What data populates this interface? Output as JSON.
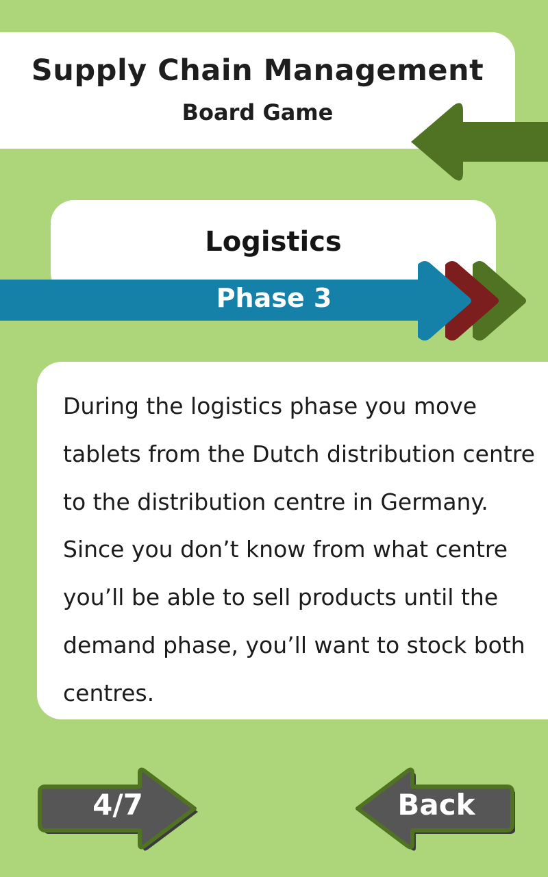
{
  "header": {
    "title": "Supply Chain Management",
    "subtitle": "Board Game"
  },
  "section": {
    "title": "Logistics",
    "phase_label": "Phase 3"
  },
  "description": {
    "text": "During the logistics phase you move tablets from the Dutch distribution centre to the distribution centre in Germany. Since you don’t know from what centre you’ll be able to sell products until the demand phase, you’ll want to stock both centres."
  },
  "navigation": {
    "page_indicator": "4/7",
    "back_label": "Back"
  },
  "colors": {
    "background": "#add579",
    "dark_green": "#4f7223",
    "blue": "#1580a8",
    "red": "#7c1e1e",
    "button_gray": "#565656"
  },
  "icons": {
    "header_arrow": "left-arrow-icon",
    "phase_arrows": "triple-chevron-right-icon",
    "page_button": "right-arrow-icon",
    "back_button": "left-arrow-icon"
  }
}
